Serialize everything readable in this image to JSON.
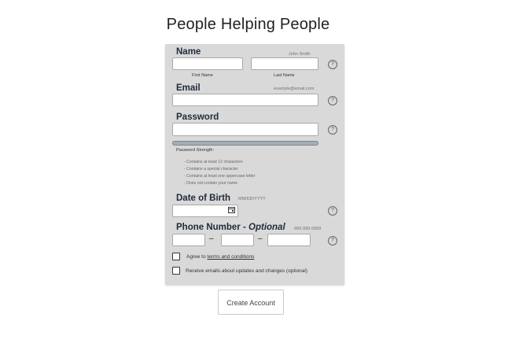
{
  "page_title": "People Helping People",
  "form": {
    "name": {
      "label": "Name",
      "hint": "John Smith",
      "first_sub": "First Name",
      "last_sub": "Last Name"
    },
    "email": {
      "label": "Email",
      "hint": "example@email.com"
    },
    "password": {
      "label": "Password",
      "strength_label": "Password Strength:",
      "requirements": [
        "- Contains at least 12 characters",
        "- Contains a special character",
        "- Contains at least one uppercase letter",
        "- Does not contain your name"
      ]
    },
    "dob": {
      "label": "Date of Birth",
      "hint": "MM/DD/YYYY"
    },
    "phone": {
      "label_main": "Phone Number - ",
      "label_optional": "Optional",
      "hint": "999-999-9999",
      "separator": "–"
    },
    "help_symbol": "?",
    "terms": {
      "prefix": "Agree to ",
      "link": "terms and conditions"
    },
    "emails_opt": "Receive emails about updates and changes (optional)"
  },
  "submit_label": "Create Account"
}
